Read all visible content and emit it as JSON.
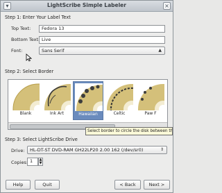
{
  "window": {
    "title": "LightScribe Simple Labeler"
  },
  "step1": {
    "title": "Step 1: Enter Your Label Text",
    "top_text_label": "Top Text:",
    "top_text_value": "Fedora 13",
    "bottom_text_label": "Bottom Text:",
    "bottom_text_value": "Live",
    "font_label": "Font:",
    "font_value": "Sans Serif"
  },
  "step2": {
    "title": "Step 2: Select Border",
    "borders": [
      {
        "label": "Blank",
        "selected": false
      },
      {
        "label": "Ink Art",
        "selected": false
      },
      {
        "label": "Hawaiian",
        "selected": true
      },
      {
        "label": "Celtic",
        "selected": false
      },
      {
        "label": "Paw F",
        "selected": false
      }
    ],
    "tooltip": "Select border to circle the disk between the top and bottom te"
  },
  "step3": {
    "title": "Step 3: Select LightScribe Drive",
    "drive_label": "Drive:",
    "drive_value": "HL-DT-ST DVD-RAM GH22LP20 2.00 162 (/dev/sr0)",
    "copies_label": "Copies:",
    "copies_value": "1"
  },
  "buttons": {
    "help": "Help",
    "quit": "Quit",
    "back": "< Back",
    "next": "Next >"
  },
  "colors": {
    "selection": "#6a8bbd",
    "disc_gold": "#d4c07a"
  }
}
